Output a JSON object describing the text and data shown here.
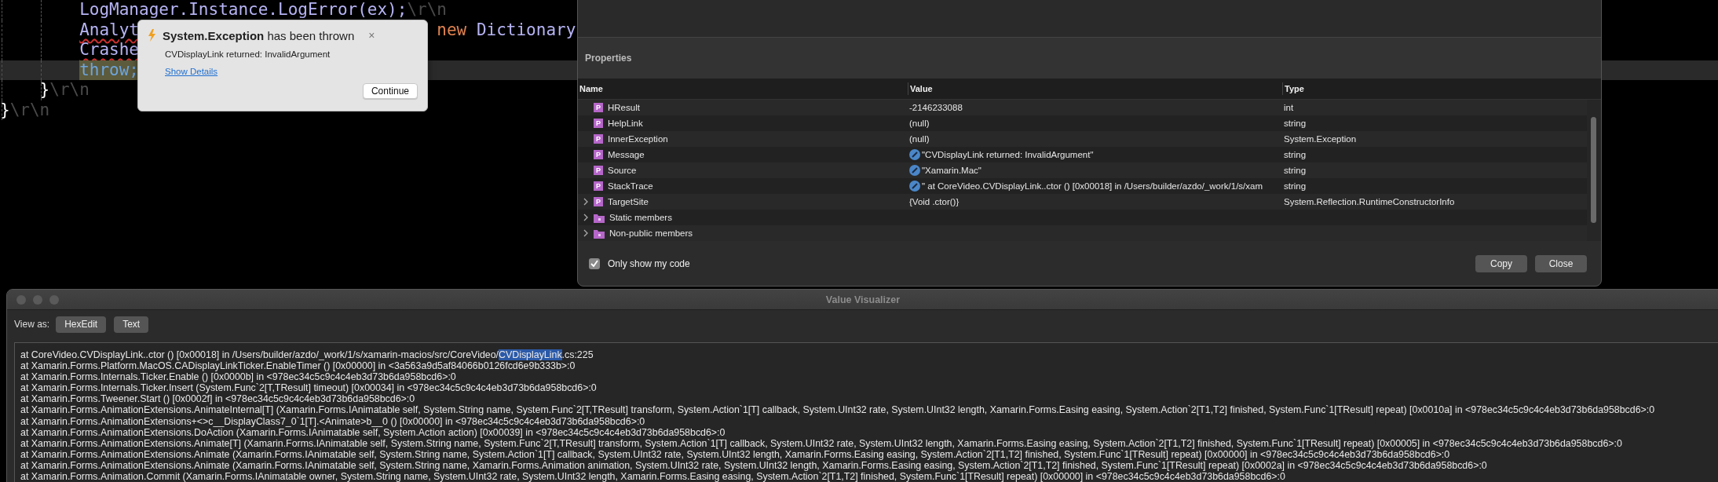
{
  "editor": {
    "lines": [
      {
        "current": false,
        "tokens": [
          {
            "text": "        LogManager.Instance.LogError(ex);",
            "kind": "ident",
            "squiggle": false,
            "highlight": false
          },
          {
            "text": "\\r\\n",
            "kind": "eol",
            "squiggle": false,
            "highlight": false
          }
        ]
      },
      {
        "current": false,
        "tokens": [
          {
            "text": "        Analyt",
            "kind": "ident",
            "squiggle": true,
            "highlight": false
          },
          {
            "text": "new",
            "kind": "keyword",
            "squiggle": false,
            "highlight": false,
            "after_covered": true
          },
          {
            "text": " Dictionary",
            "kind": "ident",
            "squiggle": false,
            "highlight": false
          }
        ]
      },
      {
        "current": false,
        "tokens": [
          {
            "text": "        Crashe",
            "kind": "ident",
            "squiggle": true,
            "highlight": false
          }
        ]
      },
      {
        "current": true,
        "tokens": [
          {
            "text": "        throw;",
            "kind": "control",
            "squiggle": false,
            "highlight": true
          }
        ]
      },
      {
        "current": false,
        "tokens": [
          {
            "text": "    }",
            "kind": "punct",
            "squiggle": false,
            "highlight": false
          },
          {
            "text": "\\r\\n",
            "kind": "eol",
            "squiggle": false,
            "highlight": false
          }
        ]
      },
      {
        "current": false,
        "tokens": [
          {
            "text": "}",
            "kind": "punct",
            "squiggle": false,
            "highlight": false
          },
          {
            "text": "\\r\\n",
            "kind": "eol",
            "squiggle": false,
            "highlight": false
          }
        ]
      }
    ]
  },
  "popup": {
    "title": "**System.Exception** has been thrown",
    "close": "×",
    "message": "CVDisplayLink returned: InvalidArgument",
    "link": "Show Details",
    "button": "Continue"
  },
  "dialog": {
    "section_title": "Properties",
    "columns": [
      "Name",
      "Value",
      "Type"
    ],
    "rows": [
      {
        "kind": "property",
        "badge": "P",
        "name": "HResult",
        "value": "-2146233088",
        "type": "int",
        "expandable": false,
        "editable": false
      },
      {
        "kind": "property",
        "badge": "P",
        "name": "HelpLink",
        "value": "(null)",
        "type": "string",
        "expandable": false,
        "editable": false
      },
      {
        "kind": "property",
        "badge": "P",
        "name": "InnerException",
        "value": "(null)",
        "type": "System.Exception",
        "expandable": false,
        "editable": false
      },
      {
        "kind": "property",
        "badge": "P",
        "name": "Message",
        "value": "\"CVDisplayLink returned: InvalidArgument\"",
        "type": "string",
        "expandable": false,
        "editable": true
      },
      {
        "kind": "property",
        "badge": "P",
        "name": "Source",
        "value": "\"Xamarin.Mac\"",
        "type": "string",
        "expandable": false,
        "editable": true
      },
      {
        "kind": "property",
        "badge": "P",
        "name": "StackTrace",
        "value": "\"  at CoreVideo.CVDisplayLink..ctor () [0x00018] in /Users/builder/azdo/_work/1/s/xam",
        "type": "string",
        "expandable": false,
        "editable": true
      },
      {
        "kind": "property",
        "badge": "P",
        "name": "TargetSite",
        "value": "{Void .ctor()}",
        "type": "System.Reflection.RuntimeConstructorInfo",
        "expandable": true,
        "editable": false
      },
      {
        "kind": "group",
        "name": "Static members",
        "expandable": true
      },
      {
        "kind": "group",
        "name": "Non-public members",
        "expandable": true
      }
    ],
    "only_my_code": {
      "label": "Only show my code",
      "checked": true
    },
    "buttons": [
      "Copy",
      "Close"
    ]
  },
  "visualizer": {
    "title": "Value Visualizer",
    "view_as_label": "View as:",
    "view_modes": [
      "HexEdit",
      "Text"
    ],
    "lines": [
      {
        "text": "at CoreVideo.CVDisplayLink..ctor () [0x00018] in /Users/builder/azdo/_work/1/s/xamarin-macios/src/CoreVideo/",
        "selected": "CVDisplayLink",
        "after": ".cs:225"
      },
      {
        "text": "at Xamarin.Forms.Platform.MacOS.CADisplayLinkTicker.EnableTimer () [0x00000] in <3a563a9d5af84066b0126fcd6e9b333b>:0"
      },
      {
        "text": "at Xamarin.Forms.Internals.Ticker.Enable () [0x0000b] in <978ec34c5c9c4c4eb3d73b6da958bcd6>:0"
      },
      {
        "text": "at Xamarin.Forms.Internals.Ticker.Insert (System.Func`2[T,TResult] timeout) [0x00034] in <978ec34c5c9c4c4eb3d73b6da958bcd6>:0"
      },
      {
        "text": "at Xamarin.Forms.Tweener.Start () [0x0002f] in <978ec34c5c9c4c4eb3d73b6da958bcd6>:0"
      },
      {
        "text": "at Xamarin.Forms.AnimationExtensions.AnimateInternal[T] (Xamarin.Forms.IAnimatable self, System.String name, System.Func`2[T,TResult] transform, System.Action`1[T] callback, System.UInt32 rate, System.UInt32 length, Xamarin.Forms.Easing easing, System.Action`2[T1,T2] finished, System.Func`1[TResult] repeat) [0x0010a] in <978ec34c5c9c4c4eb3d73b6da958bcd6>:0"
      },
      {
        "text": "at Xamarin.Forms.AnimationExtensions+<>c__DisplayClass7_0`1[T].<Animate>b__0 () [0x00000] in <978ec34c5c9c4c4eb3d73b6da958bcd6>:0"
      },
      {
        "text": "at Xamarin.Forms.AnimationExtensions.DoAction (Xamarin.Forms.IAnimatable self, System.Action action) [0x00039] in <978ec34c5c9c4c4eb3d73b6da958bcd6>:0"
      },
      {
        "text": "at Xamarin.Forms.AnimationExtensions.Animate[T] (Xamarin.Forms.IAnimatable self, System.String name, System.Func`2[T,TResult] transform, System.Action`1[T] callback, System.UInt32 rate, System.UInt32 length, Xamarin.Forms.Easing easing, System.Action`2[T1,T2] finished, System.Func`1[TResult] repeat) [0x00005] in <978ec34c5c9c4c4eb3d73b6da958bcd6>:0"
      },
      {
        "text": "at Xamarin.Forms.AnimationExtensions.Animate (Xamarin.Forms.IAnimatable self, System.String name, System.Action`1[T] callback, System.UInt32 rate, System.UInt32 length, Xamarin.Forms.Easing easing, System.Action`2[T1,T2] finished, System.Func`1[TResult] repeat) [0x00000] in <978ec34c5c9c4c4eb3d73b6da958bcd6>:0"
      },
      {
        "text": "at Xamarin.Forms.AnimationExtensions.Animate (Xamarin.Forms.IAnimatable self, System.String name, Xamarin.Forms.Animation animation, System.UInt32 rate, System.UInt32 length, Xamarin.Forms.Easing easing, System.Action`2[T1,T2] finished, System.Func`1[TResult] repeat) [0x0002a] in <978ec34c5c9c4c4eb3d73b6da958bcd6>:0"
      },
      {
        "text": "at Xamarin.Forms.Animation.Commit (Xamarin.Forms.IAnimatable owner, System.String name, System.UInt32 rate, System.UInt32 length, Xamarin.Forms.Easing easing, System.Action`2[T1,T2] finished, System.Func`1[TResult] repeat) [0x00000] in <978ec34c5c9c4c4eb3d73b6da958bcd6>:0"
      }
    ]
  }
}
